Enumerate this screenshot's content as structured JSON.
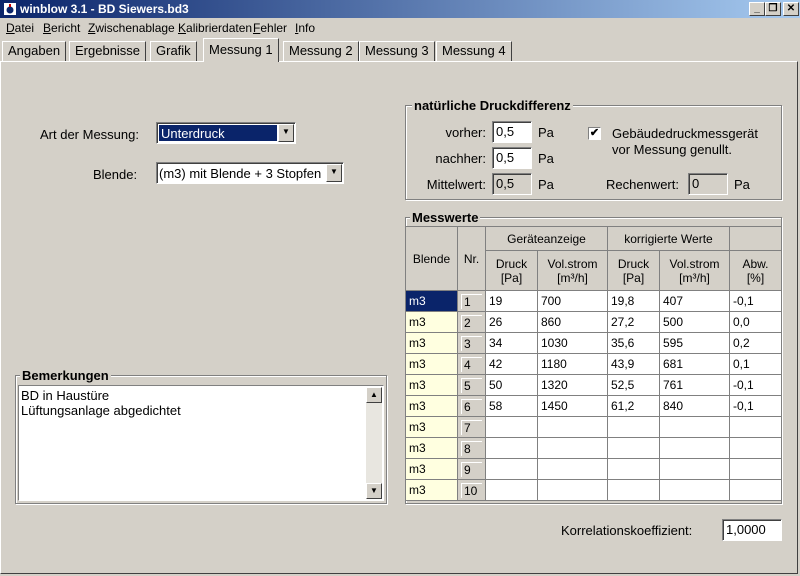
{
  "window": {
    "title": "winblow 3.1 - BD Siewers.bd3",
    "minimize_glyph": "_",
    "restore_glyph": "❐",
    "close_glyph": "✕",
    "icon": "app-icon"
  },
  "menu": [
    {
      "pre": "",
      "u": "D",
      "post": "atei"
    },
    {
      "pre": "",
      "u": "B",
      "post": "ericht"
    },
    {
      "pre": "",
      "u": "Z",
      "post": "wischenablage"
    },
    {
      "pre": "",
      "u": "K",
      "post": "alibrierdaten"
    },
    {
      "pre": "",
      "u": "F",
      "post": "ehler"
    },
    {
      "pre": "",
      "u": "I",
      "post": "nfo"
    }
  ],
  "tabs": [
    "Angaben",
    "Ergebnisse",
    "Grafik",
    "Messung 1",
    "Messung 2",
    "Messung 3",
    "Messung 4"
  ],
  "active_tab": "Messung 1",
  "art": {
    "label": "Art der Messung:",
    "value": "Unterdruck"
  },
  "blende": {
    "label": "Blende:",
    "value": "(m3)  mit Blende + 3 Stopfen"
  },
  "druck": {
    "title": "natürliche Druckdifferenz",
    "vorher_label": "vorher:",
    "vorher_value": "0,5",
    "nachher_label": "nachher:",
    "nachher_value": "0,5",
    "mittel_label": "Mittelwert:",
    "mittel_value": "0,5",
    "unit": "Pa",
    "checkbox_mark": "✔",
    "checkbox_line1": "Gebäudedruckmessgerät",
    "checkbox_line2": "vor Messung genullt.",
    "rechen_label": "Rechenwert:",
    "rechen_value": "0"
  },
  "mess": {
    "title": "Messwerte",
    "group1": "Geräteanzeige",
    "group2": "korrigierte Werte",
    "headers": {
      "blende": "Blende",
      "nr": "Nr.",
      "druck1_a": "Druck",
      "druck1_b": "[Pa]",
      "vol1_a": "Vol.strom",
      "vol1_b": "[m³/h]",
      "druck2_a": "Druck",
      "druck2_b": "[Pa]",
      "vol2_a": "Vol.strom",
      "vol2_b": "[m³/h]",
      "abw_a": "Abw.",
      "abw_b": "[%]"
    },
    "rows": [
      {
        "blende": "m3",
        "nr": "1",
        "druck": "19",
        "vol": "700",
        "kdruck": "19,8",
        "kvol": "407",
        "abw": "-0,1"
      },
      {
        "blende": "m3",
        "nr": "2",
        "druck": "26",
        "vol": "860",
        "kdruck": "27,2",
        "kvol": "500",
        "abw": "0,0"
      },
      {
        "blende": "m3",
        "nr": "3",
        "druck": "34",
        "vol": "1030",
        "kdruck": "35,6",
        "kvol": "595",
        "abw": "0,2"
      },
      {
        "blende": "m3",
        "nr": "4",
        "druck": "42",
        "vol": "1180",
        "kdruck": "43,9",
        "kvol": "681",
        "abw": "0,1"
      },
      {
        "blende": "m3",
        "nr": "5",
        "druck": "50",
        "vol": "1320",
        "kdruck": "52,5",
        "kvol": "761",
        "abw": "-0,1"
      },
      {
        "blende": "m3",
        "nr": "6",
        "druck": "58",
        "vol": "1450",
        "kdruck": "61,2",
        "kvol": "840",
        "abw": "-0,1"
      },
      {
        "blende": "m3",
        "nr": "7",
        "druck": "",
        "vol": "",
        "kdruck": "",
        "kvol": "",
        "abw": ""
      },
      {
        "blende": "m3",
        "nr": "8",
        "druck": "",
        "vol": "",
        "kdruck": "",
        "kvol": "",
        "abw": ""
      },
      {
        "blende": "m3",
        "nr": "9",
        "druck": "",
        "vol": "",
        "kdruck": "",
        "kvol": "",
        "abw": ""
      },
      {
        "blende": "m3",
        "nr": "10",
        "druck": "",
        "vol": "",
        "kdruck": "",
        "kvol": "",
        "abw": ""
      }
    ]
  },
  "bemerkungen": {
    "title": "Bemerkungen",
    "lines": [
      "BD in Haustüre",
      "Lüftungsanlage abgedichtet"
    ]
  },
  "korrelation": {
    "label": "Korrelationskoeffizient:",
    "value": "1,0000"
  }
}
